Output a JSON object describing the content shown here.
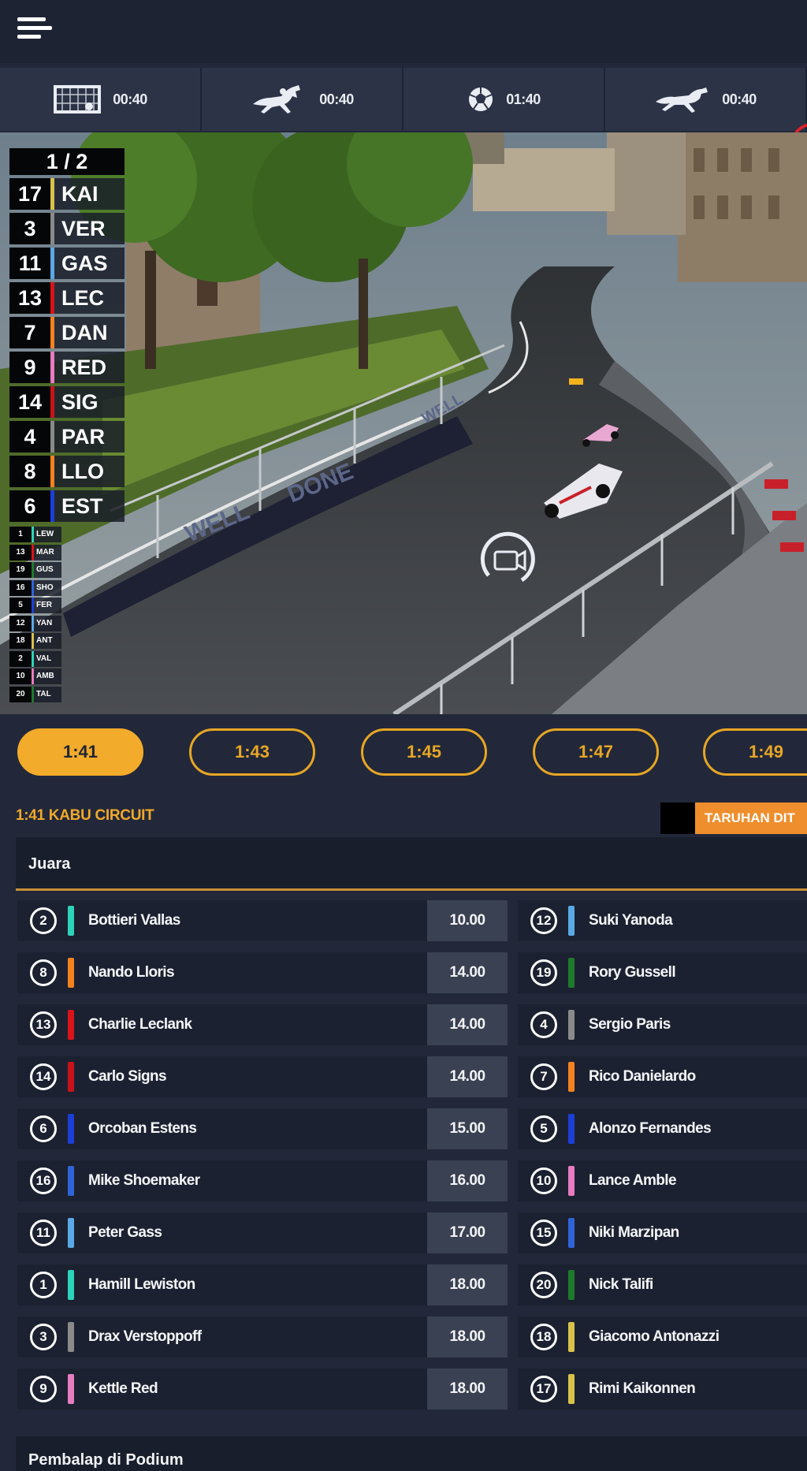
{
  "header": {
    "menu_icon": "hamburger-menu-icon"
  },
  "game_tabs": [
    {
      "icon": "football-goal-icon",
      "time": "00:40"
    },
    {
      "icon": "horse-racing-icon",
      "time": "00:40"
    },
    {
      "icon": "soccer-ball-icon",
      "time": "01:40"
    },
    {
      "icon": "greyhound-icon",
      "time": "00:40"
    }
  ],
  "video": {
    "leaderboard": {
      "page": "1 / 2",
      "rows": [
        {
          "pos": "17",
          "code": "KAI",
          "color": "#d7c24a"
        },
        {
          "pos": "3",
          "code": "VER",
          "color": "#8a8a8a"
        },
        {
          "pos": "11",
          "code": "GAS",
          "color": "#5aa9e6"
        },
        {
          "pos": "13",
          "code": "LEC",
          "color": "#d8141a"
        },
        {
          "pos": "7",
          "code": "DAN",
          "color": "#f2821f"
        },
        {
          "pos": "9",
          "code": "RED",
          "color": "#e77cc0"
        },
        {
          "pos": "14",
          "code": "SIG",
          "color": "#c8121a"
        },
        {
          "pos": "4",
          "code": "PAR",
          "color": "#8a8a8a"
        },
        {
          "pos": "8",
          "code": "LLO",
          "color": "#f2821f"
        },
        {
          "pos": "6",
          "code": "EST",
          "color": "#1b3fd6"
        }
      ],
      "small_rows": [
        {
          "pos": "1",
          "code": "LEW",
          "color": "#2dd3b8"
        },
        {
          "pos": "13",
          "code": "MAR",
          "color": "#d8141a"
        },
        {
          "pos": "19",
          "code": "GUS",
          "color": "#1d7a2a"
        },
        {
          "pos": "16",
          "code": "SHO",
          "color": "#2f64d8"
        },
        {
          "pos": "5",
          "code": "FER",
          "color": "#1b3fd6"
        },
        {
          "pos": "12",
          "code": "YAN",
          "color": "#5aa9e6"
        },
        {
          "pos": "18",
          "code": "ANT",
          "color": "#d7c24a"
        },
        {
          "pos": "2",
          "code": "VAL",
          "color": "#2dd3b8"
        },
        {
          "pos": "10",
          "code": "AMB",
          "color": "#e77cc0"
        },
        {
          "pos": "20",
          "code": "TAL",
          "color": "#1d7a2a"
        }
      ]
    },
    "banner_text_1": "WELL",
    "banner_text_2": "DONE",
    "banner_text_3": "WELL",
    "camera_icon": "camera-switch-icon"
  },
  "race_times": [
    "1:41",
    "1:43",
    "1:45",
    "1:47",
    "1:49"
  ],
  "active_time": "1:41",
  "section": {
    "title": "1:41 KABU CIRCUIT",
    "bet_button": "TARUHAN DIT",
    "market_title": "Juara"
  },
  "colors": {
    "accent": "#f2ab2a",
    "bet_orange": "#ef8e2c",
    "background": "#22283a",
    "row_bg": "#1c2131",
    "odds_bg": "#3a4152"
  },
  "winner_left": [
    {
      "num": "2",
      "name": "Bottieri Vallas",
      "color": "#2dd3b8",
      "odds": "10.00"
    },
    {
      "num": "8",
      "name": "Nando Lloris",
      "color": "#f2821f",
      "odds": "14.00"
    },
    {
      "num": "13",
      "name": "Charlie Leclank",
      "color": "#d8141a",
      "odds": "14.00"
    },
    {
      "num": "14",
      "name": "Carlo Signs",
      "color": "#c8121a",
      "odds": "14.00"
    },
    {
      "num": "6",
      "name": "Orcoban Estens",
      "color": "#1b3fd6",
      "odds": "15.00"
    },
    {
      "num": "16",
      "name": "Mike Shoemaker",
      "color": "#2f64d8",
      "odds": "16.00"
    },
    {
      "num": "11",
      "name": "Peter Gass",
      "color": "#5aa9e6",
      "odds": "17.00"
    },
    {
      "num": "1",
      "name": "Hamill Lewiston",
      "color": "#2dd3b8",
      "odds": "18.00"
    },
    {
      "num": "3",
      "name": "Drax Verstoppoff",
      "color": "#8a8a8a",
      "odds": "18.00"
    },
    {
      "num": "9",
      "name": "Kettle Red",
      "color": "#e77cc0",
      "odds": "18.00"
    }
  ],
  "winner_right": [
    {
      "num": "12",
      "name": "Suki Yanoda",
      "color": "#5aa9e6"
    },
    {
      "num": "19",
      "name": "Rory Gussell",
      "color": "#1d7a2a"
    },
    {
      "num": "4",
      "name": "Sergio Paris",
      "color": "#8a8a8a"
    },
    {
      "num": "7",
      "name": "Rico Danielardo",
      "color": "#f2821f"
    },
    {
      "num": "5",
      "name": "Alonzo Fernandes",
      "color": "#1b3fd6"
    },
    {
      "num": "10",
      "name": "Lance Amble",
      "color": "#e77cc0"
    },
    {
      "num": "15",
      "name": "Niki Marzipan",
      "color": "#2f64d8"
    },
    {
      "num": "20",
      "name": "Nick Talifi",
      "color": "#1d7a2a"
    },
    {
      "num": "18",
      "name": "Giacomo Antonazzi",
      "color": "#d7c24a"
    },
    {
      "num": "17",
      "name": "Rimi Kaikonnen",
      "color": "#d7c24a"
    }
  ],
  "podium_market_title": "Pembalap di Podium"
}
